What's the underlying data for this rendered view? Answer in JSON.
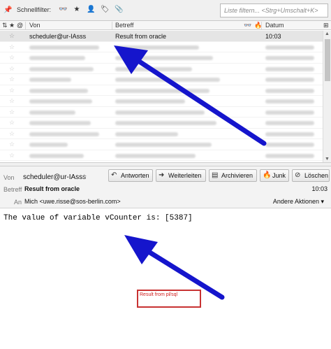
{
  "filterbar": {
    "label": "Schnellfilter:",
    "icons": [
      "pin-icon",
      "unread-filter-icon",
      "starred-filter-icon",
      "contact-filter-icon",
      "tag-filter-icon",
      "attachment-filter-icon"
    ],
    "search_placeholder": "Liste filtern... <Strg+Umschalt+K>"
  },
  "columns": {
    "from": "Von",
    "subject": "Betreff",
    "date": "Datum"
  },
  "messages": [
    {
      "from": "scheduler@ur-IAsss",
      "subject": "Result from oracle",
      "date": "10:03",
      "selected": true
    }
  ],
  "blurred_row_count": 11,
  "header": {
    "from_label": "Von",
    "from_value": "scheduler@ur-IAsss",
    "subject_label": "Betreff",
    "subject_value": "Result from oracle",
    "to_label": "An",
    "to_value": "Mich <uwe.risse@sos-berlin.com>",
    "time": "10:03",
    "more_actions": "Andere Aktionen ▾"
  },
  "buttons": {
    "reply": "Antworten",
    "forward": "Weiterleiten",
    "archive": "Archivieren",
    "junk": "Junk",
    "delete": "Löschen"
  },
  "body_text": "The value of variable vCounter is: [5387]",
  "annotation": {
    "label": "Result from pl/sql",
    "arrow_color": "#1515cc",
    "box_color": "#c83232"
  }
}
